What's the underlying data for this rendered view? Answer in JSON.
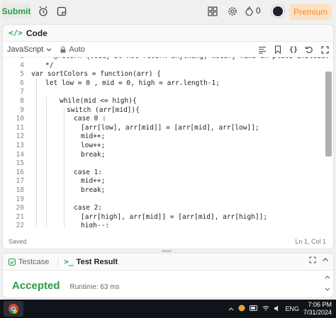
{
  "toolbar": {
    "submit_label": "Submit",
    "streak_count": "0",
    "premium_label": "Premium"
  },
  "code_panel": {
    "title": "Code",
    "language": "JavaScript",
    "auto_label": "Auto",
    "saved_label": "Saved",
    "cursor_position": "Ln 1, Col 1"
  },
  "code_lines": [
    {
      "num": "3",
      "indent": 1,
      "text": "* @return {void} Do not return anything, modify nums in-place instead."
    },
    {
      "num": "4",
      "indent": 1,
      "text": "*/"
    },
    {
      "num": "5",
      "indent": 0,
      "text": "var sortColors = function(arr) {"
    },
    {
      "num": "6",
      "indent": 1,
      "text": "let low = 0 , mid = 0, high = arr.length-1;"
    },
    {
      "num": "7",
      "indent": 0,
      "text": ""
    },
    {
      "num": "8",
      "indent": 2,
      "text": "while(mid <= high){"
    },
    {
      "num": "9",
      "indent": 2.5,
      "text": "switch (arr[mid]){"
    },
    {
      "num": "10",
      "indent": 3,
      "text": "case 0 :"
    },
    {
      "num": "11",
      "indent": 3.5,
      "text": "[arr[low], arr[mid]] = [arr[mid], arr[low]];"
    },
    {
      "num": "12",
      "indent": 3.5,
      "text": "mid++;"
    },
    {
      "num": "13",
      "indent": 3.5,
      "text": "low++;"
    },
    {
      "num": "14",
      "indent": 3.5,
      "text": "break;"
    },
    {
      "num": "15",
      "indent": 0,
      "text": ""
    },
    {
      "num": "16",
      "indent": 3,
      "text": "case 1:"
    },
    {
      "num": "17",
      "indent": 3.5,
      "text": "mid++;"
    },
    {
      "num": "18",
      "indent": 3.5,
      "text": "break;"
    },
    {
      "num": "19",
      "indent": 0,
      "text": ""
    },
    {
      "num": "20",
      "indent": 3,
      "text": "case 2:"
    },
    {
      "num": "21",
      "indent": 3.5,
      "text": "[arr[high], arr[mid]] = [arr[mid], arr[high]];"
    },
    {
      "num": "22",
      "indent": 3.5,
      "text": "high--;"
    }
  ],
  "bottom_panel": {
    "tab_testcase": "Testcase",
    "tab_result": "Test Result",
    "status": "Accepted",
    "runtime": "Runtime: 63 ms"
  },
  "taskbar": {
    "language": "ENG",
    "time": "7:06 PM",
    "date": "7/31/2024"
  },
  "colors": {
    "accent_green": "#2a9d43",
    "premium_orange": "#f08c2e"
  }
}
